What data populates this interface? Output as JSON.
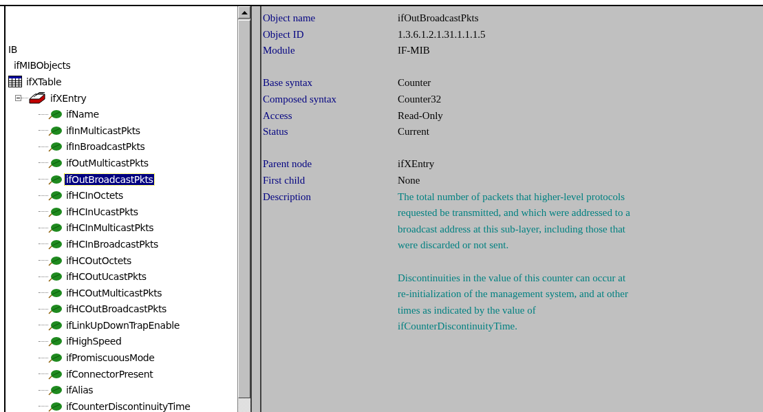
{
  "tree": [
    {
      "label": "IB",
      "children": [
        {
          "label": "ifMIBObjects",
          "children": [
            {
              "label": "ifXTable",
              "kind": "table",
              "children": [
                {
                  "label": "ifXEntry",
                  "kind": "entry",
                  "expanded": true,
                  "children": [
                    {
                      "label": "ifName",
                      "kind": "leaf",
                      "selected": false
                    },
                    {
                      "label": "ifInMulticastPkts",
                      "kind": "leaf",
                      "selected": false
                    },
                    {
                      "label": "ifInBroadcastPkts",
                      "kind": "leaf",
                      "selected": false
                    },
                    {
                      "label": "ifOutMulticastPkts",
                      "kind": "leaf",
                      "selected": false
                    },
                    {
                      "label": "ifOutBroadcastPkts",
                      "kind": "leaf",
                      "selected": true
                    },
                    {
                      "label": "ifHCInOctets",
                      "kind": "leaf",
                      "selected": false
                    },
                    {
                      "label": "ifHCInUcastPkts",
                      "kind": "leaf",
                      "selected": false
                    },
                    {
                      "label": "ifHCInMulticastPkts",
                      "kind": "leaf",
                      "selected": false
                    },
                    {
                      "label": "ifHCInBroadcastPkts",
                      "kind": "leaf",
                      "selected": false
                    },
                    {
                      "label": "ifHCOutOctets",
                      "kind": "leaf",
                      "selected": false
                    },
                    {
                      "label": "ifHCOutUcastPkts",
                      "kind": "leaf",
                      "selected": false
                    },
                    {
                      "label": "ifHCOutMulticastPkts",
                      "kind": "leaf",
                      "selected": false
                    },
                    {
                      "label": "ifHCOutBroadcastPkts",
                      "kind": "leaf",
                      "selected": false
                    },
                    {
                      "label": "ifLinkUpDownTrapEnable",
                      "kind": "leaf",
                      "selected": false
                    },
                    {
                      "label": "ifHighSpeed",
                      "kind": "leaf",
                      "selected": false
                    },
                    {
                      "label": "ifPromiscuousMode",
                      "kind": "leaf",
                      "selected": false
                    },
                    {
                      "label": "ifConnectorPresent",
                      "kind": "leaf",
                      "selected": false
                    },
                    {
                      "label": "ifAlias",
                      "kind": "leaf",
                      "selected": false
                    },
                    {
                      "label": "ifCounterDiscontinuityTime",
                      "kind": "leaf",
                      "selected": false
                    }
                  ]
                }
              ]
            }
          ]
        }
      ]
    }
  ],
  "details": {
    "groups": [
      [
        {
          "label": "Object name",
          "value": "ifOutBroadcastPkts"
        },
        {
          "label": "Object ID",
          "value": "1.3.6.1.2.1.31.1.1.1.5"
        },
        {
          "label": "Module",
          "value": "IF-MIB"
        }
      ],
      [
        {
          "label": "Base syntax",
          "value": "Counter"
        },
        {
          "label": "Composed syntax",
          "value": "Counter32"
        },
        {
          "label": "Access",
          "value": "Read-Only"
        },
        {
          "label": "Status",
          "value": "Current"
        }
      ],
      [
        {
          "label": "Parent node",
          "value": "ifXEntry"
        },
        {
          "label": "First child",
          "value": "None"
        },
        {
          "label": "Description",
          "paragraphs": [
            "The total number of packets that higher-level protocols requested be transmitted, and which were addressed to a broadcast address at this sub-layer, including those that were discarded or not sent.",
            "Discontinuities in the value of this counter can occur at re-initialization of the management system, and at other times as indicated by the value of ifCounterDiscontinuityTime."
          ]
        }
      ]
    ]
  }
}
